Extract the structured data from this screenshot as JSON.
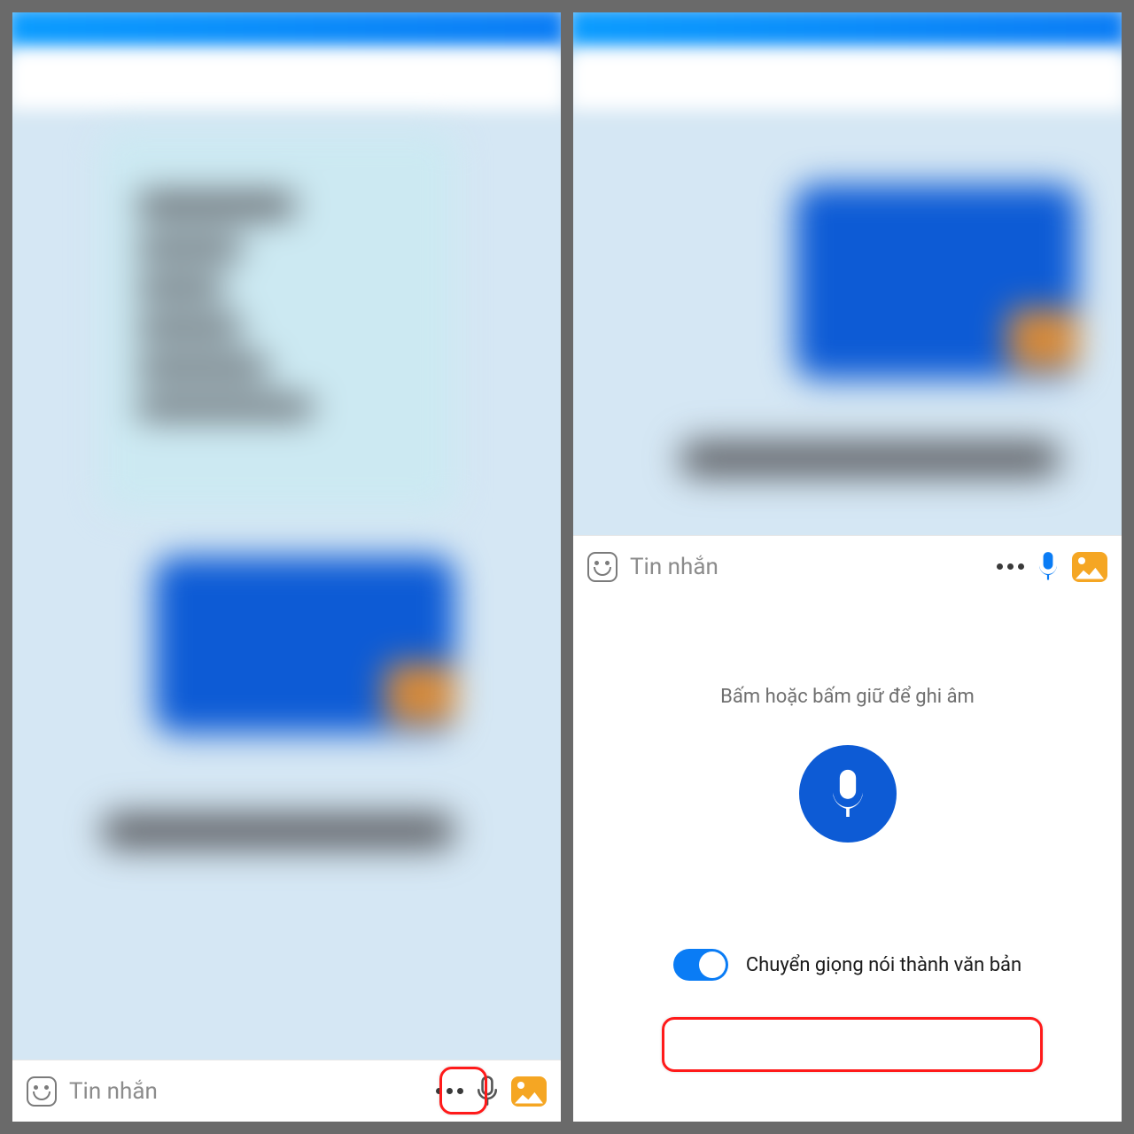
{
  "input": {
    "placeholder": "Tin nhắn"
  },
  "voice": {
    "hint": "Bấm hoặc bấm giữ để ghi âm",
    "toggle_label": "Chuyển giọng nói thành văn bản"
  }
}
